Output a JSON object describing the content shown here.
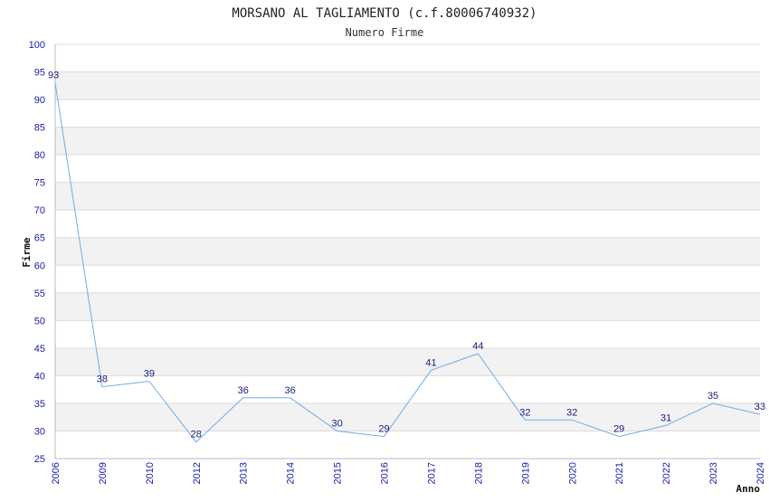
{
  "chart_data": {
    "type": "line",
    "title": "MORSANO AL TAGLIAMENTO (c.f.80006740932)",
    "subtitle": "Numero Firme",
    "xlabel": "Anno",
    "ylabel": "Firme",
    "ylim": [
      25,
      100
    ],
    "ytick_step": 5,
    "grid": true,
    "categories": [
      "2006",
      "2009",
      "2010",
      "2012",
      "2013",
      "2014",
      "2015",
      "2016",
      "2017",
      "2018",
      "2019",
      "2020",
      "2021",
      "2022",
      "2023",
      "2024"
    ],
    "series": [
      {
        "values": [
          93,
          38,
          39,
          28,
          36,
          36,
          30,
          29,
          41,
          44,
          32,
          32,
          29,
          31,
          35,
          33
        ]
      }
    ],
    "colors": {
      "line": "#6aaeea",
      "band": "#f2f2f2",
      "grid": "#dcdcdc",
      "tick": "#1a1aa6",
      "label": "#1a1a80"
    }
  }
}
